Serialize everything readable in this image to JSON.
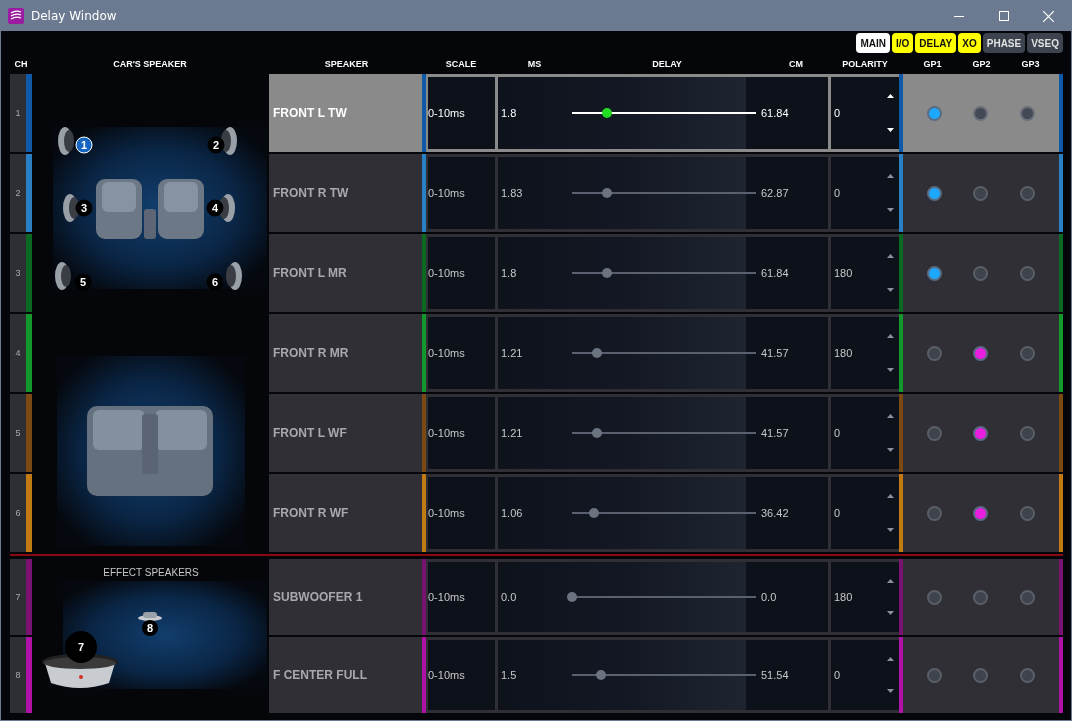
{
  "window": {
    "title": "Delay Window"
  },
  "nav_tabs": [
    {
      "label": "MAIN",
      "selected": true,
      "highlighted": false
    },
    {
      "label": "I/O",
      "selected": false,
      "highlighted": true
    },
    {
      "label": "DELAY",
      "selected": false,
      "highlighted": true
    },
    {
      "label": "XO",
      "selected": false,
      "highlighted": true
    },
    {
      "label": "PHASE",
      "selected": false,
      "highlighted": false
    },
    {
      "label": "VSEQ",
      "selected": false,
      "highlighted": false
    }
  ],
  "columns": {
    "ch": "CH",
    "car_speaker": "CAR'S SPEAKER",
    "speaker": "SPEAKER",
    "scale": "SCALE",
    "ms": "MS",
    "delay": "DELAY",
    "cm": "CM",
    "polarity": "POLARITY"
  },
  "groups": [
    {
      "label": "GP1",
      "color": "#1ea7ff"
    },
    {
      "label": "GP2",
      "color": "#e81ee0"
    },
    {
      "label": "GP3"
    }
  ],
  "sections": [
    {
      "kind": "car",
      "badges": [
        {
          "label": "1",
          "selected": true
        },
        {
          "label": "2",
          "selected": false
        },
        {
          "label": "3",
          "selected": false
        },
        {
          "label": "4",
          "selected": false
        },
        {
          "label": "5",
          "selected": false
        },
        {
          "label": "6",
          "selected": false
        }
      ],
      "channels": [
        {
          "ch": "1",
          "color": "#0f5aa8",
          "speaker": "FRONT L TW",
          "selected": true,
          "scale": "0-10ms",
          "ms": "1.8",
          "level": 0.19,
          "cm": "61.84",
          "polarity": "0",
          "groups": [
            {
              "selected": true
            },
            {
              "selected": false
            },
            {
              "selected": false
            }
          ]
        },
        {
          "ch": "2",
          "color": "#2a80c4",
          "speaker": "FRONT R TW",
          "selected": false,
          "scale": "0-10ms",
          "ms": "1.83",
          "level": 0.19,
          "cm": "62.87",
          "polarity": "0",
          "groups": [
            {
              "selected": true
            },
            {
              "selected": false
            },
            {
              "selected": false
            }
          ]
        },
        {
          "ch": "3",
          "color": "#0b6a22",
          "speaker": "FRONT L MR",
          "selected": false,
          "scale": "0-10ms",
          "ms": "1.8",
          "level": 0.19,
          "cm": "61.84",
          "polarity": "180",
          "groups": [
            {
              "selected": true
            },
            {
              "selected": false
            },
            {
              "selected": false
            }
          ]
        },
        {
          "ch": "4",
          "color": "#13982c",
          "speaker": "FRONT R MR",
          "selected": false,
          "scale": "0-10ms",
          "ms": "1.21",
          "level": 0.135,
          "cm": "41.57",
          "polarity": "180",
          "groups": [
            {
              "selected": false
            },
            {
              "selected": true
            },
            {
              "selected": false
            }
          ]
        },
        {
          "ch": "5",
          "color": "#7a4a12",
          "speaker": "FRONT L WF",
          "selected": false,
          "scale": "0-10ms",
          "ms": "1.21",
          "level": 0.135,
          "cm": "41.57",
          "polarity": "0",
          "groups": [
            {
              "selected": false
            },
            {
              "selected": true
            },
            {
              "selected": false
            }
          ]
        },
        {
          "ch": "6",
          "color": "#c27a12",
          "speaker": "FRONT R WF",
          "selected": false,
          "scale": "0-10ms",
          "ms": "1.06",
          "level": 0.12,
          "cm": "36.42",
          "polarity": "0",
          "groups": [
            {
              "selected": false
            },
            {
              "selected": true
            },
            {
              "selected": false
            }
          ]
        }
      ]
    },
    {
      "kind": "effect",
      "title": "EFFECT SPEAKERS",
      "badges": [
        {
          "label": "7",
          "selected": false
        },
        {
          "label": "8",
          "selected": false
        }
      ],
      "channels": [
        {
          "ch": "7",
          "color": "#7a1272",
          "speaker": "SUBWOOFER 1",
          "selected": false,
          "scale": "0-10ms",
          "ms": "0.0",
          "level": 0,
          "cm": "0.0",
          "polarity": "180",
          "groups": [
            {
              "selected": false
            },
            {
              "selected": false
            },
            {
              "selected": false
            }
          ]
        },
        {
          "ch": "8",
          "color": "#b012a8",
          "speaker": "F CENTER FULL",
          "selected": false,
          "scale": "0-10ms",
          "ms": "1.5",
          "level": 0.16,
          "cm": "51.54",
          "polarity": "0",
          "groups": [
            {
              "selected": false
            },
            {
              "selected": false
            },
            {
              "selected": false
            }
          ]
        }
      ]
    }
  ]
}
